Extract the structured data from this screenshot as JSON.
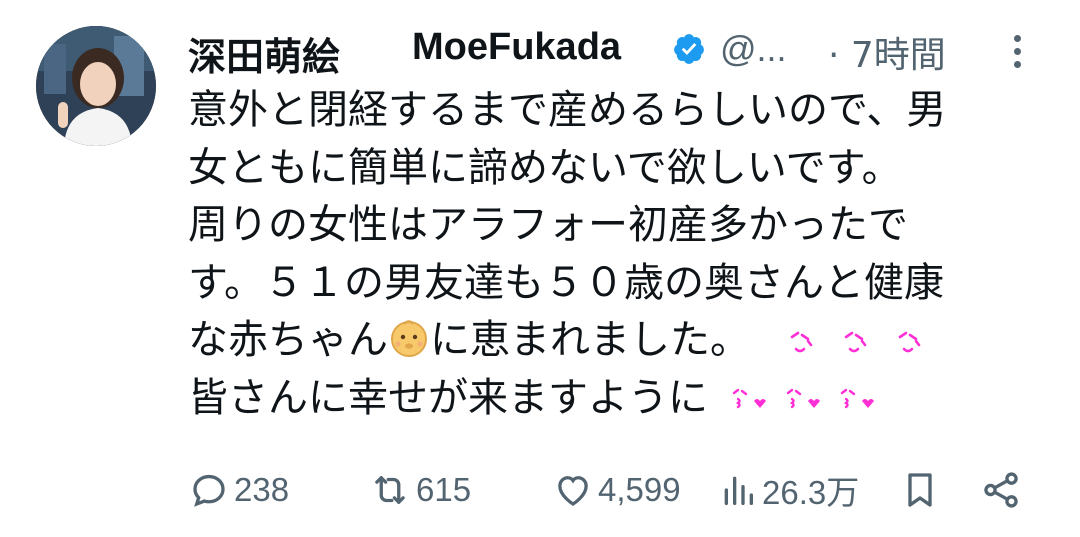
{
  "author": {
    "display_name_jp": "深田萌絵",
    "display_name_en": "MoeFukada",
    "handle": "@...",
    "time": "· 7時間",
    "verified_icon": "verified-badge-icon",
    "verified_color": "#1d9bf0"
  },
  "tweet": {
    "lines": [
      "意外と閉経するまで産めるらしいので、男",
      "女ともに簡単に諦めないで欲しいです。",
      "周りの女性はアラフォー初産多かったで",
      "す。５１の男友達も５０歳の奥さんと健康"
    ],
    "line5_before": "な赤ちゃん",
    "line5_after": "に恵まれました。",
    "line6": "皆さんに幸せが来ますように"
  },
  "actions": {
    "replies": "238",
    "retweets": "615",
    "likes": "4,599",
    "views": "26.3万"
  },
  "colors": {
    "text": "#0f1419",
    "secondary": "#536471",
    "emoji_pink": "#ff2fd6",
    "baby_face": "#f8c96b"
  }
}
